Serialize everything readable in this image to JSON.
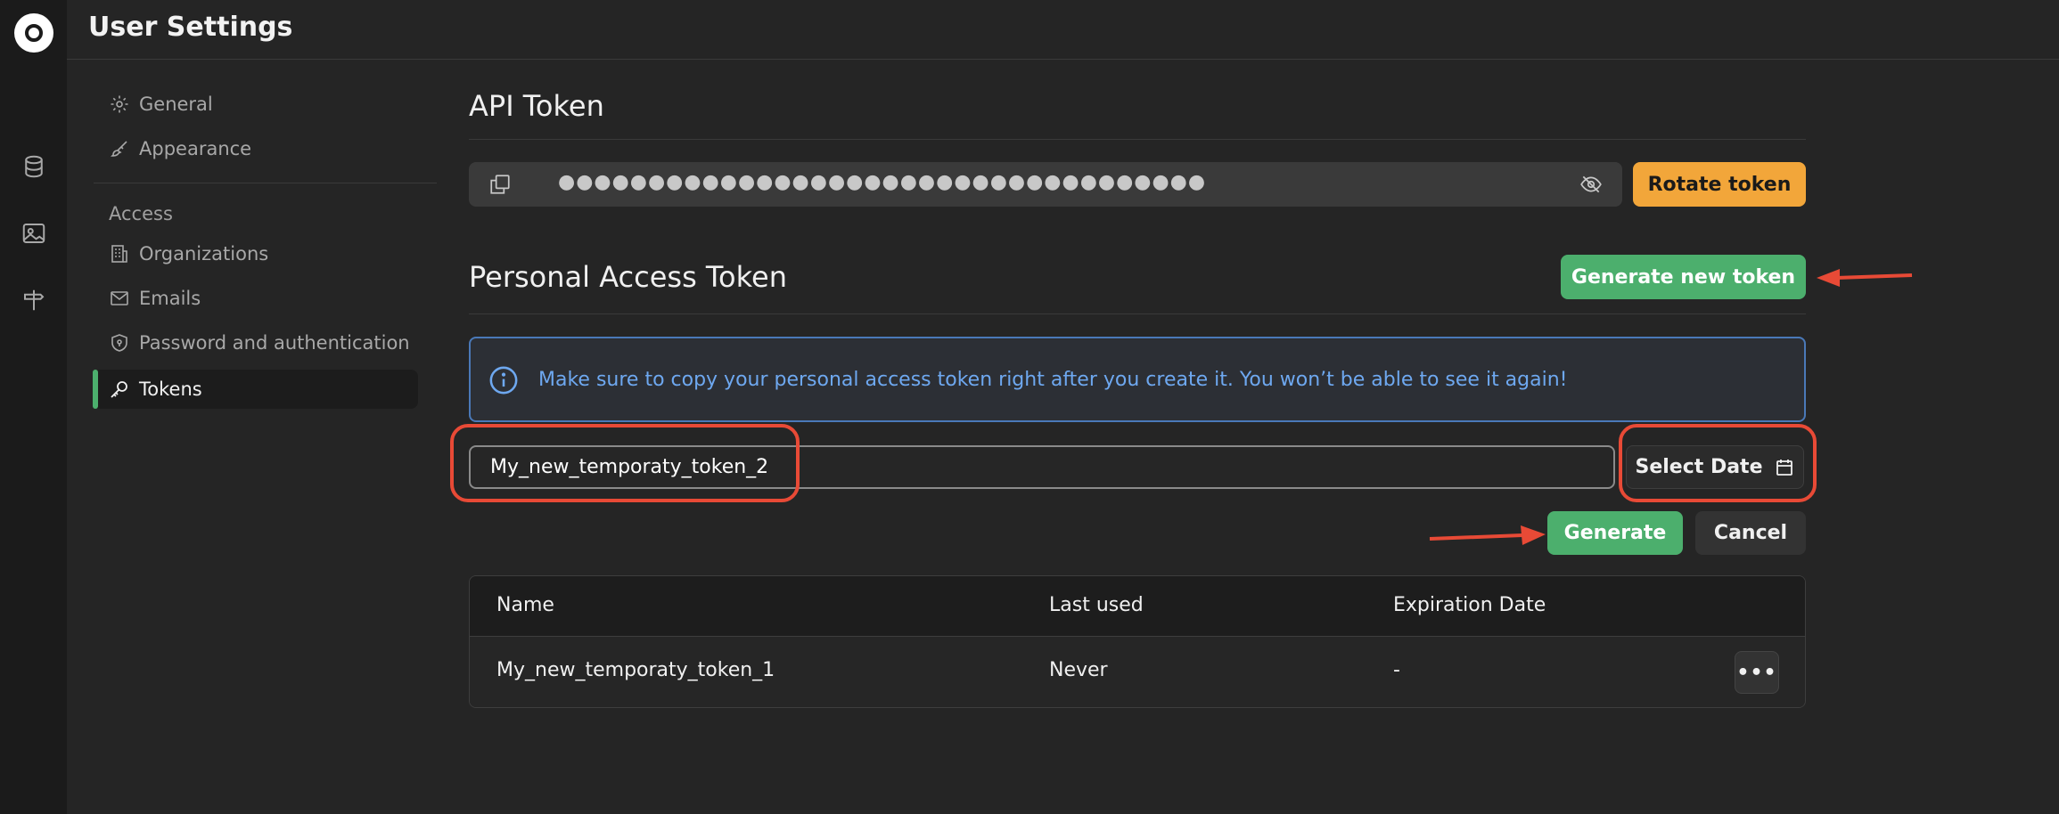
{
  "app": {
    "title": "User Settings"
  },
  "nav": {
    "general": "General",
    "appearance": "Appearance",
    "section_access": "Access",
    "organizations": "Organizations",
    "emails": "Emails",
    "password": "Password and authentication",
    "tokens": "Tokens",
    "active_item": "Tokens"
  },
  "api_token": {
    "title": "API Token",
    "masked_value": "●●●●●●●●●●●●●●●●●●●●●●●●●●●●●●●●●●●●",
    "rotate_label": "Rotate token"
  },
  "pat": {
    "title": "Personal Access Token",
    "generate_new_label": "Generate new token",
    "info_text": "Make sure to copy your personal access token right after you create it. You won’t be able to see it again!",
    "name_input_value": "My_new_temporaty_token_2",
    "select_date_label": "Select Date",
    "generate_label": "Generate",
    "cancel_label": "Cancel"
  },
  "table": {
    "columns": [
      "Name",
      "Last used",
      "Expiration Date"
    ],
    "rows": [
      {
        "name": "My_new_temporaty_token_1",
        "last_used": "Never",
        "expiration": "-"
      }
    ]
  },
  "colors": {
    "accent_green": "#4caf6d",
    "accent_orange": "#f2a63a",
    "info_blue": "#6ea8f0",
    "annotation_red": "#e84a36"
  },
  "icons": {
    "rail": [
      "database-icon",
      "image-icon",
      "signpost-icon"
    ],
    "nav": [
      "gear-icon",
      "brush-icon",
      "building-icon",
      "mail-icon",
      "shield-icon",
      "key-icon"
    ]
  }
}
